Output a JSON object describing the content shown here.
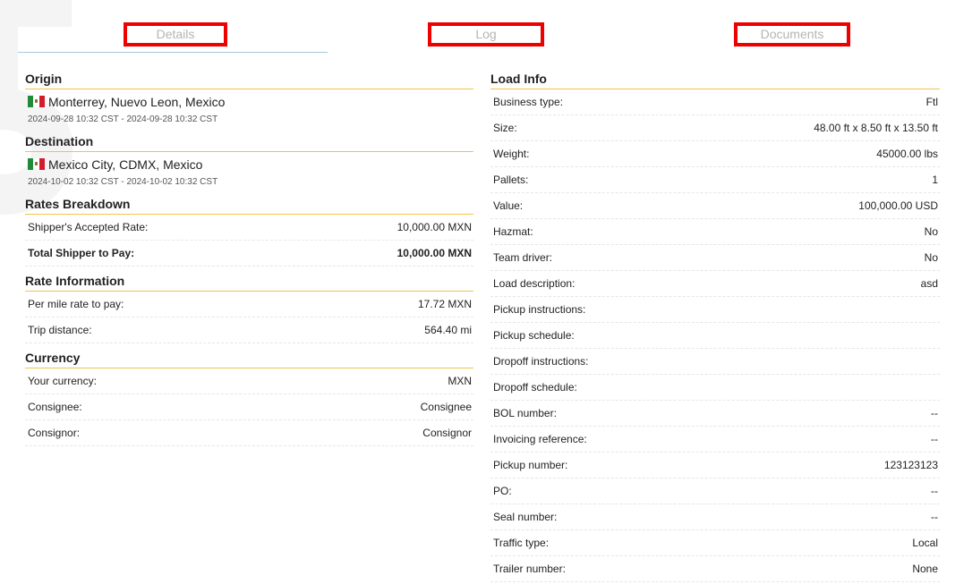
{
  "tabs": {
    "details": "Details",
    "log": "Log",
    "documents": "Documents"
  },
  "origin": {
    "title": "Origin",
    "location": "Monterrey, Nuevo Leon, Mexico",
    "dates": "2024-09-28 10:32 CST - 2024-09-28 10:32 CST"
  },
  "destination": {
    "title": "Destination",
    "location": "Mexico City, CDMX, Mexico",
    "dates": "2024-10-02 10:32 CST - 2024-10-02 10:32 CST"
  },
  "rates_breakdown": {
    "title": "Rates Breakdown",
    "rows": [
      {
        "label": "Shipper's Accepted Rate:",
        "value": "10,000.00 MXN"
      },
      {
        "label": "Total Shipper to Pay:",
        "value": "10,000.00 MXN"
      }
    ]
  },
  "rate_information": {
    "title": "Rate Information",
    "rows": [
      {
        "label": "Per mile rate to pay:",
        "value": "17.72 MXN"
      },
      {
        "label": "Trip distance:",
        "value": "564.40 mi"
      }
    ]
  },
  "currency": {
    "title": "Currency",
    "rows": [
      {
        "label": "Your currency:",
        "value": "MXN"
      },
      {
        "label": "Consignee:",
        "value": "Consignee"
      },
      {
        "label": "Consignor:",
        "value": "Consignor"
      }
    ]
  },
  "load_info": {
    "title": "Load Info",
    "rows": [
      {
        "label": "Business type:",
        "value": "Ftl"
      },
      {
        "label": "Size:",
        "value": "48.00 ft x 8.50 ft x 13.50 ft"
      },
      {
        "label": "Weight:",
        "value": "45000.00 lbs"
      },
      {
        "label": "Pallets:",
        "value": "1"
      },
      {
        "label": "Value:",
        "value": "100,000.00 USD"
      },
      {
        "label": "Hazmat:",
        "value": "No"
      },
      {
        "label": "Team driver:",
        "value": "No"
      },
      {
        "label": "Load description:",
        "value": "asd"
      },
      {
        "label": "Pickup instructions:",
        "value": ""
      },
      {
        "label": "Pickup schedule:",
        "value": ""
      },
      {
        "label": "Dropoff instructions:",
        "value": ""
      },
      {
        "label": "Dropoff schedule:",
        "value": ""
      },
      {
        "label": "BOL number:",
        "value": "--"
      },
      {
        "label": "Invoicing reference:",
        "value": "--"
      },
      {
        "label": "Pickup number:",
        "value": "123123123"
      },
      {
        "label": "PO:",
        "value": "--"
      },
      {
        "label": "Seal number:",
        "value": "--"
      },
      {
        "label": "Traffic type:",
        "value": "Local"
      },
      {
        "label": "Trailer number:",
        "value": "None"
      }
    ]
  }
}
